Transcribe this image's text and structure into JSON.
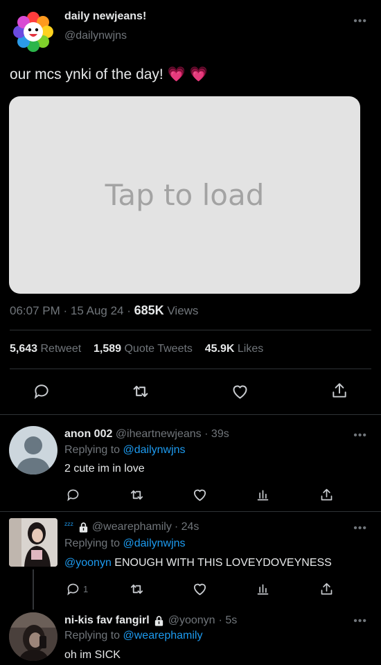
{
  "main_tweet": {
    "display_name": "daily newjeans!",
    "handle": "@dailynwjns",
    "text": "our mcs ynki of the day! 💗 💗",
    "media_placeholder": "Tap to load",
    "time": "06:07 PM",
    "date": "15 Aug 24",
    "sep": "·",
    "views_count": "685K",
    "views_label": "Views",
    "retweets_count": "5,643",
    "retweets_label": "Retweet",
    "quotes_count": "1,589",
    "quotes_label": "Quote Tweets",
    "likes_count": "45.9K",
    "likes_label": "Likes",
    "more_icon": "ellipsis-icon"
  },
  "replies": [
    {
      "display_name": "anon 002",
      "handle": "@iheartnewjeans",
      "time": "· 39s",
      "replying_prefix": "Replying to",
      "replying_to": "@dailynwjns",
      "text": "2 cute im in love",
      "reply_count": ""
    },
    {
      "display_name": "ᶻᶻᶻ",
      "handle": "@wearephamily",
      "time": "· 24s",
      "replying_prefix": "Replying to",
      "replying_to": "@dailynwjns",
      "mention": "@yoonyn",
      "text": "ENOUGH WITH THIS LOVEYDOVEYNESS",
      "reply_count": "1",
      "protected": true
    },
    {
      "display_name": "ni-kis fav fangirl",
      "handle": "@yoonyn",
      "time": "· 5s",
      "replying_prefix": "Replying to",
      "replying_to": "@wearephamily",
      "text": "oh im SICK",
      "protected": true
    }
  ],
  "colors": {
    "background": "#000000",
    "text": "#e7e9ea",
    "muted": "#71767b",
    "link": "#1d9bf0",
    "divider": "#2f3336",
    "media_bg": "#e3e3e3"
  }
}
